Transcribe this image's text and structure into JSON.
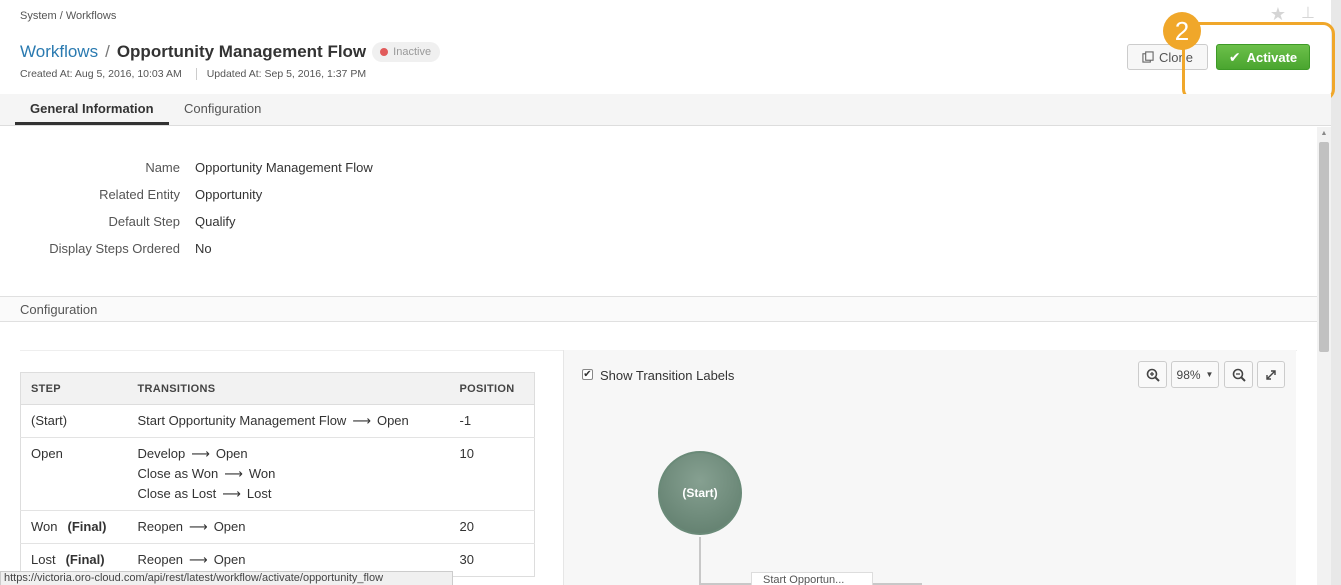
{
  "breadcrumb": "System / Workflows",
  "header": {
    "parent_link": "Workflows",
    "separator": "/",
    "title": "Opportunity Management Flow",
    "status": "Inactive",
    "created": "Created At: Aug 5, 2016, 10:03 AM",
    "updated": "Updated At: Sep 5, 2016, 1:37 PM",
    "clone_label": "Clone",
    "activate_label": "Activate",
    "callout_number": "2"
  },
  "tabs": [
    {
      "label": "General Information",
      "active": true
    },
    {
      "label": "Configuration",
      "active": false
    }
  ],
  "general": [
    {
      "label": "Name",
      "value": "Opportunity Management Flow"
    },
    {
      "label": "Related Entity",
      "value": "Opportunity"
    },
    {
      "label": "Default Step",
      "value": "Qualify"
    },
    {
      "label": "Display Steps Ordered",
      "value": "No"
    }
  ],
  "configuration": {
    "section_title": "Configuration",
    "columns": [
      "STEP",
      "TRANSITIONS",
      "POSITION"
    ],
    "rows": [
      {
        "step": "(Start)",
        "final": "",
        "transitions": [
          {
            "name": "Start Opportunity Management Flow",
            "to": "Open"
          }
        ],
        "position": "-1"
      },
      {
        "step": "Open",
        "final": "",
        "transitions": [
          {
            "name": "Develop",
            "to": "Open"
          },
          {
            "name": "Close as Won",
            "to": "Won"
          },
          {
            "name": "Close as Lost",
            "to": "Lost"
          }
        ],
        "position": "10"
      },
      {
        "step": "Won",
        "final": "(Final)",
        "transitions": [
          {
            "name": "Reopen",
            "to": "Open"
          }
        ],
        "position": "20"
      },
      {
        "step": "Lost",
        "final": "(Final)",
        "transitions": [
          {
            "name": "Reopen",
            "to": "Open"
          }
        ],
        "position": "30"
      }
    ],
    "arrow": "⟶"
  },
  "graph": {
    "show_labels_label": "Show Transition Labels",
    "show_labels_checked": true,
    "zoom_level": "98%",
    "start_node_label": "(Start)",
    "edge_label": "Start Opportun..."
  },
  "statusbar_url": "https://victoria.oro-cloud.com/api/rest/latest/workflow/activate/opportunity_flow",
  "colors": {
    "accent": "#2a7ab0",
    "activate": "#4aa52f",
    "callout": "#f0a72a",
    "inactive_dot": "#e15b5b"
  }
}
